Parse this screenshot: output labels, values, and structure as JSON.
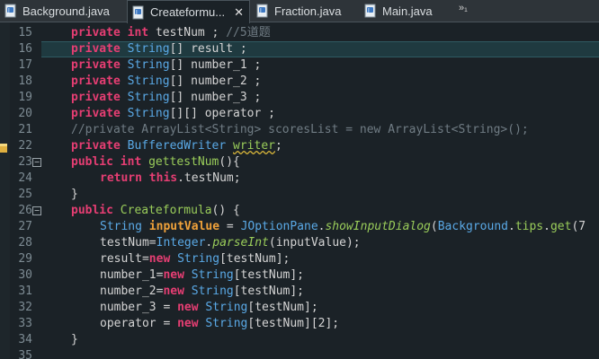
{
  "tabs": [
    {
      "label": "Background.java",
      "active": false
    },
    {
      "label": "Createformu...",
      "active": true
    },
    {
      "label": "Fraction.java",
      "active": false
    },
    {
      "label": "Main.java",
      "active": false
    }
  ],
  "tab_close": "✕",
  "overflow_label": "»₁",
  "lines": {
    "l15": {
      "num": "15",
      "p1": "private ",
      "p2": "int ",
      "p3": "testNum ; ",
      "p4": "//5道题"
    },
    "l16": {
      "num": "16",
      "p1": "private ",
      "p2": "String",
      "p3": "[] result ;"
    },
    "l17": {
      "num": "17",
      "p1": "private ",
      "p2": "String",
      "p3": "[] number_1 ;"
    },
    "l18": {
      "num": "18",
      "p1": "private ",
      "p2": "String",
      "p3": "[] number_2 ;"
    },
    "l19": {
      "num": "19",
      "p1": "private ",
      "p2": "String",
      "p3": "[] number_3 ;"
    },
    "l20": {
      "num": "20",
      "p1": "private ",
      "p2": "String",
      "p3": "[][] operator ;"
    },
    "l21": {
      "num": "21",
      "p1": "//private ArrayList<String> scoresList = new ArrayList<String>();"
    },
    "l22": {
      "num": "22",
      "p1": "private ",
      "p2": "BufferedWriter ",
      "p3": "writer",
      "p4": ";"
    },
    "l23": {
      "num": "23",
      "p1": "public ",
      "p2": "int ",
      "p3": "gettestNum",
      "p4": "(){"
    },
    "l24": {
      "num": "24",
      "p1": "return ",
      "p2": "this",
      "p3": ".testNum;"
    },
    "l25": {
      "num": "25",
      "p1": "}"
    },
    "l26": {
      "num": "26",
      "p1": "public ",
      "p2": "Createformula",
      "p3": "() {"
    },
    "l27": {
      "num": "27",
      "p1": "String ",
      "p2": "inputValue",
      "p3": " = ",
      "p4": "JOptionPane",
      "p5": ".",
      "p6": "showInputDialog",
      "p7": "(",
      "p8": "Background",
      "p9": ".",
      "p10": "tips",
      "p11": ".",
      "p12": "get",
      "p13": "(7"
    },
    "l28": {
      "num": "28",
      "p1": "testNum=",
      "p2": "Integer",
      "p3": ".",
      "p4": "parseInt",
      "p5": "(inputValue);"
    },
    "l29": {
      "num": "29",
      "p1": "result=",
      "p2": "new ",
      "p3": "String",
      "p4": "[testNum];"
    },
    "l30": {
      "num": "30",
      "p1": "number_1=",
      "p2": "new ",
      "p3": "String",
      "p4": "[testNum];"
    },
    "l31": {
      "num": "31",
      "p1": "number_2=",
      "p2": "new ",
      "p3": "String",
      "p4": "[testNum];"
    },
    "l32": {
      "num": "32",
      "p1": "number_3 = ",
      "p2": "new ",
      "p3": "String",
      "p4": "[testNum];"
    },
    "l33": {
      "num": "33",
      "p1": "operator = ",
      "p2": "new ",
      "p3": "String",
      "p4": "[testNum][2];"
    },
    "l34": {
      "num": "34",
      "p1": "}"
    },
    "l35": {
      "num": "35"
    }
  },
  "fold_markers": {
    "collapse": "−"
  },
  "colors": {
    "background": "#1b2227",
    "keyword": "#e63e73",
    "type": "#5aa9e6",
    "method": "#9acd5a",
    "local_variable": "#f0a23a",
    "comment": "#707c84",
    "line_highlight": "#1f3a40"
  },
  "icons": {
    "java_file": "java-file-icon",
    "warning": "warning-marker-icon",
    "fold": "fold-collapse-icon"
  }
}
